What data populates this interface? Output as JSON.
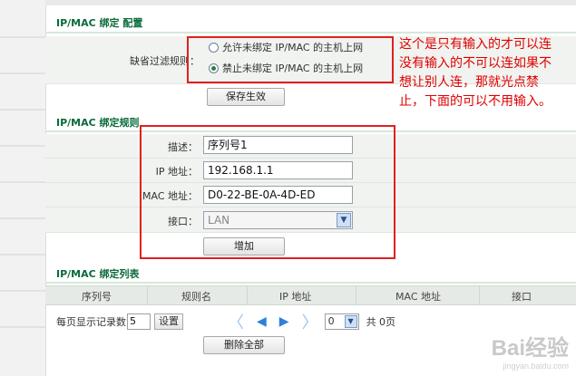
{
  "binding_config": {
    "title": "IP/MAC 绑定 配置",
    "filter_label": "缺省过滤规则：",
    "options": [
      {
        "label": "允许未绑定 IP/MAC 的主机上网",
        "selected": false
      },
      {
        "label": "禁止未绑定 IP/MAC 的主机上网",
        "selected": true
      }
    ],
    "save_label": "保存生效"
  },
  "annotation": {
    "lines": [
      "这个是只有输入的才可以连",
      "没有输入的不可以连如果不",
      "想让别人连，那就光点禁",
      "止，下面的可以不用输入。"
    ]
  },
  "binding_rule": {
    "title": "IP/MAC 绑定规则",
    "fields": {
      "desc": {
        "label": "描述：",
        "value": "序列号1"
      },
      "ip": {
        "label": "IP 地址：",
        "value": "192.168.1.1"
      },
      "mac": {
        "label": "MAC 地址：",
        "value": "D0-22-BE-0A-4D-ED"
      },
      "iface": {
        "label": "接口：",
        "value": "LAN"
      }
    },
    "add_label": "增加"
  },
  "binding_list": {
    "title": "IP/MAC 绑定列表",
    "columns": [
      "序列号",
      "规则名",
      "IP 地址",
      "MAC 地址",
      "接口"
    ],
    "per_page_label": "每页显示记录数",
    "per_page_value": "5",
    "set_label": "设置",
    "page_value": "0",
    "total_label": "共 0页",
    "delete_all_label": "删除全部"
  },
  "watermark": {
    "text": "Bai经验",
    "sub": "jingyan.baidu.com"
  },
  "colors": {
    "section_title": "#0a6a3b",
    "annotation": "#e00000",
    "accent_box": "#e02020"
  }
}
